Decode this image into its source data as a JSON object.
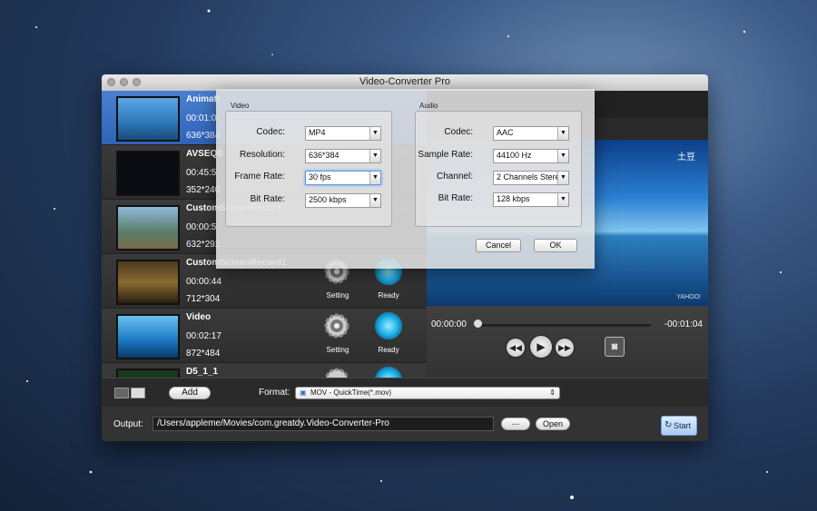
{
  "window": {
    "title": "Video-Converter Pro"
  },
  "files": [
    {
      "name": "Animati",
      "duration": "00:01:0",
      "resolution": "636*384",
      "selected": true
    },
    {
      "name": "AVSEQ0",
      "duration": "00:45:5",
      "resolution": "352*240",
      "selected": false
    },
    {
      "name": "CustomScreenRecord",
      "duration": "00:00:5",
      "resolution": "632*292",
      "selected": false
    },
    {
      "name": "CustomScreenRecord1",
      "duration": "00:00:44",
      "resolution": "712*304",
      "selected": false
    },
    {
      "name": "Video",
      "duration": "00:02:17",
      "resolution": "872*484",
      "selected": false
    },
    {
      "name": "D5_1_1",
      "duration": "",
      "resolution": "",
      "selected": false
    }
  ],
  "row_labels": {
    "setting": "Setting",
    "ready": "Ready"
  },
  "preview": {
    "time_start": "00:00:00",
    "time_end": "-00:01:04",
    "watermark": "土豆",
    "corner_mark": "YAHOO!"
  },
  "toolbar": {
    "add_label": "Add",
    "format_label": "Format:",
    "format_value": "MOV - QuickTime(*.mov)"
  },
  "output": {
    "label": "Output:",
    "path": "/Users/appleme/Movies/com.greatdy.Video-Converter-Pro",
    "browse_label": "...",
    "open_label": "Open",
    "start_label": "Start"
  },
  "dialog": {
    "video": {
      "title": "Video",
      "codec_label": "Codec:",
      "codec": "MP4",
      "resolution_label": "Resolution:",
      "resolution": "636*384",
      "framerate_label": "Frame Rate:",
      "framerate": "30 fps",
      "bitrate_label": "Bit Rate:",
      "bitrate": "2500 kbps"
    },
    "audio": {
      "title": "Audio",
      "codec_label": "Codec:",
      "codec": "AAC",
      "samplerate_label": "Sample Rate:",
      "samplerate": "44100 Hz",
      "channel_label": "Channel:",
      "channel": "2 Channels Stereo",
      "bitrate_label": "Bit Rate:",
      "bitrate": "128 kbps"
    },
    "cancel_label": "Cancel",
    "ok_label": "OK"
  },
  "colors": {
    "selection": "#3a70c6",
    "ready": "#24b6ea"
  }
}
